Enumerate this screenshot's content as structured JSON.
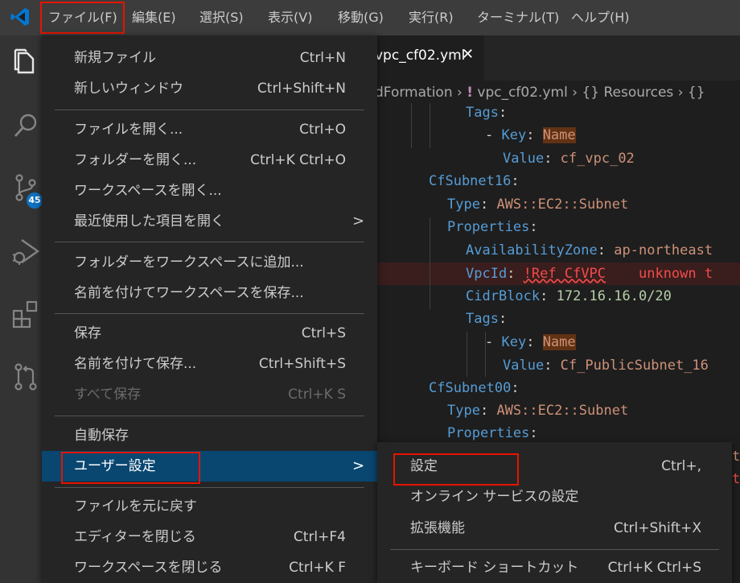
{
  "menubar": {
    "items": [
      "ファイル(F)",
      "編集(E)",
      "選択(S)",
      "表示(V)",
      "移動(G)",
      "実行(R)",
      "ターミナル(T)",
      "ヘルプ(H)"
    ]
  },
  "activity_bar": {
    "icons": [
      "explorer-icon",
      "search-icon",
      "source-control-icon",
      "run-debug-icon",
      "extensions-icon",
      "pull-request-icon"
    ],
    "scm_badge": "45"
  },
  "editor": {
    "tab_label": "vpc_cf02.yml",
    "breadcrumb": {
      "folder": "dFormation",
      "file_icon": "!",
      "file": "vpc_cf02.yml",
      "symbol1": "{} Resources",
      "symbol2": "{}"
    },
    "code": {
      "l1_key": "Tags",
      "l2_key": "Key",
      "l2_val": "Name",
      "l3_key": "Value",
      "l3_val": "cf_vpc_02",
      "l4_key": "CfSubnet16",
      "l5_key": "Type",
      "l5_val": "AWS::EC2::Subnet",
      "l6_key": "Properties",
      "l7_key": "AvailabilityZone",
      "l7_val": "ap-northeast",
      "l8_key": "VpcId",
      "l8_val": "!Ref CfVPC",
      "l8_err": "unknown t",
      "l9_key": "CidrBlock",
      "l9_val": "172.16.16.0/20",
      "l10_key": "Tags",
      "l11_key": "Key",
      "l11_val": "Name",
      "l12_key": "Value",
      "l12_val": "Cf_PublicSubnet_16",
      "l13_key": "CfSubnet00",
      "l14_key": "Type",
      "l14_val": "AWS::EC2::Subnet",
      "l15_key": "Properties",
      "tail_a": "t",
      "tail_b": "t"
    }
  },
  "file_menu": {
    "new_file": "新規ファイル",
    "new_file_sc": "Ctrl+N",
    "new_window": "新しいウィンドウ",
    "new_window_sc": "Ctrl+Shift+N",
    "open_file": "ファイルを開く...",
    "open_file_sc": "Ctrl+O",
    "open_folder": "フォルダーを開く...",
    "open_folder_sc": "Ctrl+K Ctrl+O",
    "open_workspace": "ワークスペースを開く...",
    "open_recent": "最近使用した項目を開く",
    "add_folder": "フォルダーをワークスペースに追加...",
    "save_workspace_as": "名前を付けてワークスペースを保存...",
    "save": "保存",
    "save_sc": "Ctrl+S",
    "save_as": "名前を付けて保存...",
    "save_as_sc": "Ctrl+Shift+S",
    "save_all": "すべて保存",
    "save_all_sc": "Ctrl+K S",
    "auto_save": "自動保存",
    "preferences": "ユーザー設定",
    "revert": "ファイルを元に戻す",
    "close_editor": "エディターを閉じる",
    "close_editor_sc": "Ctrl+F4",
    "close_workspace": "ワークスペースを閉じる",
    "close_workspace_sc": "Ctrl+K F"
  },
  "preferences_submenu": {
    "settings": "設定",
    "settings_sc": "Ctrl+,",
    "online_services": "オンライン サービスの設定",
    "extensions": "拡張機能",
    "extensions_sc": "Ctrl+Shift+X",
    "keyboard_shortcuts": "キーボード ショートカット",
    "keyboard_shortcuts_sc": "Ctrl+K Ctrl+S"
  },
  "colors": {
    "menubar": "#3c3c3c",
    "menu_bg": "#252526",
    "selection": "#094771",
    "highlight_box": "#e51400",
    "activity_bar": "#333333",
    "editor_bg": "#1e1e1e"
  }
}
